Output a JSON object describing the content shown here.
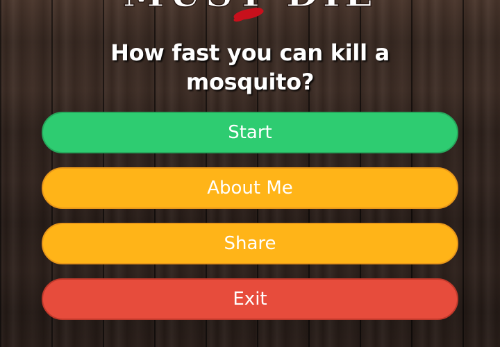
{
  "logo": {
    "text": "MUST DIE",
    "text_color": "#ffffff",
    "splat_color": "#c8101c"
  },
  "headline": {
    "line1": "How fast you can kill a",
    "line2": "mosquito?"
  },
  "menu": {
    "buttons": [
      {
        "id": "start",
        "label": "Start",
        "color": "#2ecc71",
        "border": "#27a85c"
      },
      {
        "id": "about",
        "label": "About Me",
        "color": "#ffb418",
        "border": "#e8971a"
      },
      {
        "id": "share",
        "label": "Share",
        "color": "#ffb418",
        "border": "#e8971a"
      },
      {
        "id": "exit",
        "label": "Exit",
        "color": "#e74c3c",
        "border": "#c0392b"
      }
    ]
  }
}
